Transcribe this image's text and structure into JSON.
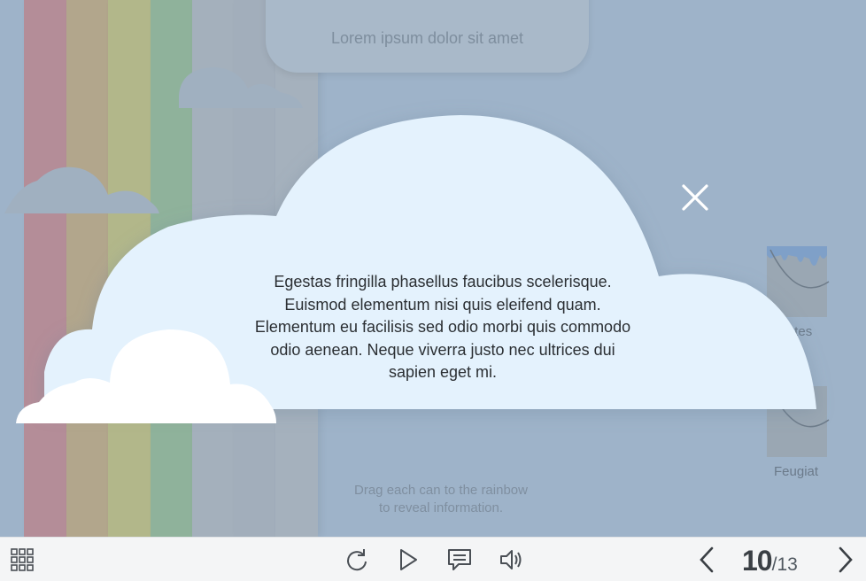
{
  "slide": {
    "title": "Lorem ipsum dolor sit amet",
    "hint_line1": "Drag each can to the rainbow",
    "hint_line2": "to reveal information.",
    "cans": [
      {
        "label": "...entes"
      },
      {
        "label": "Feugiat"
      }
    ],
    "rainbow_colors": [
      "#b48d98",
      "#b2a68c",
      "#b2b78a",
      "#8fb29b",
      "#a4b0bc",
      "#a2aebb",
      "#a5b1bd"
    ]
  },
  "popup": {
    "text_lines": [
      "Egestas fringilla phasellus faucibus scelerisque.",
      "Euismod elementum nisi quis eleifend quam.",
      "Elementum eu facilisis sed odio morbi quis commodo",
      "odio aenean. Neque viverra justo nec ultrices dui",
      "sapien eget mi."
    ],
    "close_icon": "close-icon",
    "cloud_color": "#e4f2fd"
  },
  "toolbar": {
    "menu_icon": "grid-menu-icon",
    "replay_icon": "replay-icon",
    "play_icon": "play-icon",
    "captions_icon": "captions-icon",
    "volume_icon": "volume-icon",
    "prev_icon": "chevron-left-icon",
    "next_icon": "chevron-right-icon",
    "current_page": "10",
    "separator": "/",
    "total_pages": "13"
  }
}
